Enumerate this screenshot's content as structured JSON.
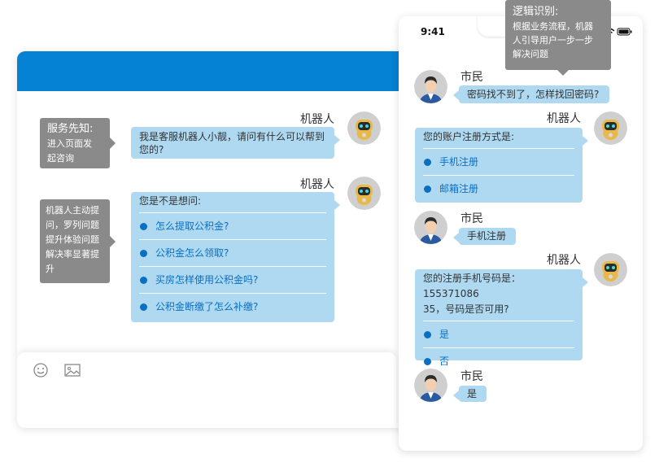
{
  "callouts": {
    "service_notice": {
      "title": "服务先知:",
      "line1": "进入页面发",
      "line2": "起咨询"
    },
    "proactive": {
      "line1": "机器人主动提",
      "line2": "问，罗列问题",
      "line3": "提升体验问题",
      "line4": "解决率显著提",
      "line5": "升"
    },
    "logic": {
      "title": "逻辑识别:",
      "line1": "根据业务流程，机器",
      "line2": "人引导用户一步一步",
      "line3": "解决问题"
    }
  },
  "desktop": {
    "messages": [
      {
        "sender": "机器人",
        "text_line1": "我是客服机器人小靓，请问有什么可以帮到",
        "text_line2": "您的?"
      },
      {
        "sender": "机器人",
        "text": "您是不是想问:",
        "options": [
          "怎么提取公积金?",
          "公积金怎么领取?",
          "买房怎样使用公积金吗?",
          "公积金断缴了怎么补缴?"
        ]
      }
    ],
    "toolbar": {
      "emoji_icon": "smiley-icon",
      "image_icon": "image-icon"
    }
  },
  "phone": {
    "status_time": "9:41",
    "messages": [
      {
        "sender": "市民",
        "text": "密码找不到了，怎样找回密码?"
      },
      {
        "sender": "机器人",
        "text": "您的账户注册方式是:",
        "options": [
          "手机注册",
          "邮箱注册"
        ]
      },
      {
        "sender": "市民",
        "text": "手机注册"
      },
      {
        "sender": "机器人",
        "text_line1": "您的注册手机号码是：155371086",
        "text_line2": "35，号码是否可用?",
        "options": [
          "是",
          "否"
        ]
      },
      {
        "sender": "市民",
        "text": "是"
      }
    ]
  },
  "colors": {
    "header_blue": "#0582d3",
    "bubble_blue": "#aed9f1",
    "option_blue": "#0a6fc2",
    "callout_gray": "#8a8a8a"
  }
}
